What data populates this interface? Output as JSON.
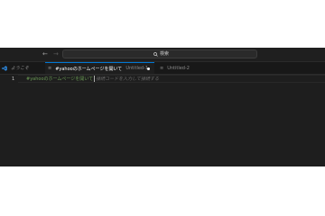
{
  "titlebar": {
    "back_icon": "arrow-left-icon",
    "forward_icon": "arrow-right-icon",
    "search_placeholder": "検索"
  },
  "tabs": {
    "welcome": {
      "label": "ようこそ",
      "icon": "vscode-logo-icon"
    },
    "untitled1": {
      "label": "#yahooのホームページを開いて",
      "sub": "Untitled-1",
      "dirty": true
    },
    "untitled2": {
      "label": "Untitled-2"
    }
  },
  "editor": {
    "line_number": "1",
    "code": "#yahooのホームページを開いて",
    "hint": "接続コードを入力して接続する"
  },
  "colors": {
    "accent": "#0078d4",
    "comment": "#6a9955",
    "editor_bg": "#1e1e1e"
  }
}
